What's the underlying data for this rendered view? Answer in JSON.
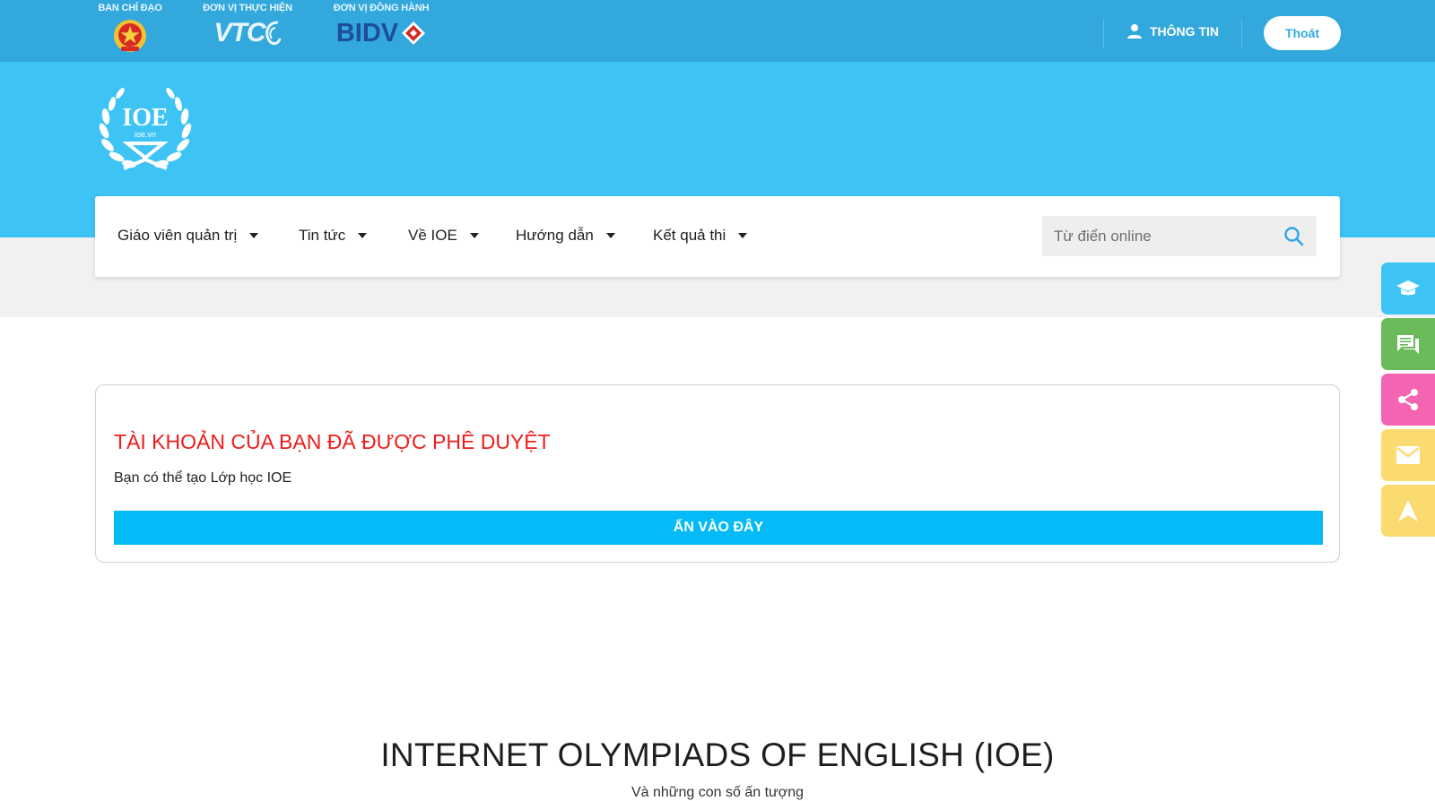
{
  "topbar": {
    "sponsors": [
      {
        "caption": "BAN CHỈ ĐẠO",
        "logo": "national-emblem"
      },
      {
        "caption": "ĐƠN VỊ THỰC HIỆN",
        "logo": "vtc-logo",
        "logo_text": "VTC"
      },
      {
        "caption": "ĐƠN VỊ ĐỒNG HÀNH",
        "logo": "bidv-logo",
        "logo_text": "BIDV"
      }
    ],
    "user_label": "THÔNG TIN",
    "logout_label": "Thoát"
  },
  "header": {
    "logo_text": "IOE",
    "logo_subtext": "ioe.vn"
  },
  "nav": {
    "items": [
      {
        "label": "Giáo viên quản trị"
      },
      {
        "label": "Tin tức"
      },
      {
        "label": "Về IOE"
      },
      {
        "label": "Hướng dẫn"
      },
      {
        "label": "Kết quả thi"
      }
    ],
    "search_placeholder": "Từ điển online",
    "search_value": ""
  },
  "side_buttons": [
    {
      "icon": "graduation-cap-icon",
      "color": "#3ec3f5"
    },
    {
      "icon": "chat-icon",
      "color": "#6cbb5a"
    },
    {
      "icon": "share-icon",
      "color": "#f365b2"
    },
    {
      "icon": "mail-icon",
      "color": "#fbdb6f"
    },
    {
      "icon": "arrow-up-icon",
      "color": "#fbdb6f"
    }
  ],
  "approval": {
    "title": "TÀI KHOẢN CỦA BẠN ĐÃ ĐƯỢC PHÊ DUYỆT",
    "text": "Bạn có thể tạo Lớp học IOE",
    "button_label": "ẤN VÀO ĐÂY"
  },
  "main": {
    "headline": "INTERNET OLYMPIADS OF ENGLISH (IOE)",
    "subheadline": "Và những con số ấn tượng"
  },
  "colors": {
    "topbar": "#32a8dc",
    "header": "#3ec3f5",
    "approval_title": "#ee1c1c",
    "approval_button": "#04baf7"
  }
}
